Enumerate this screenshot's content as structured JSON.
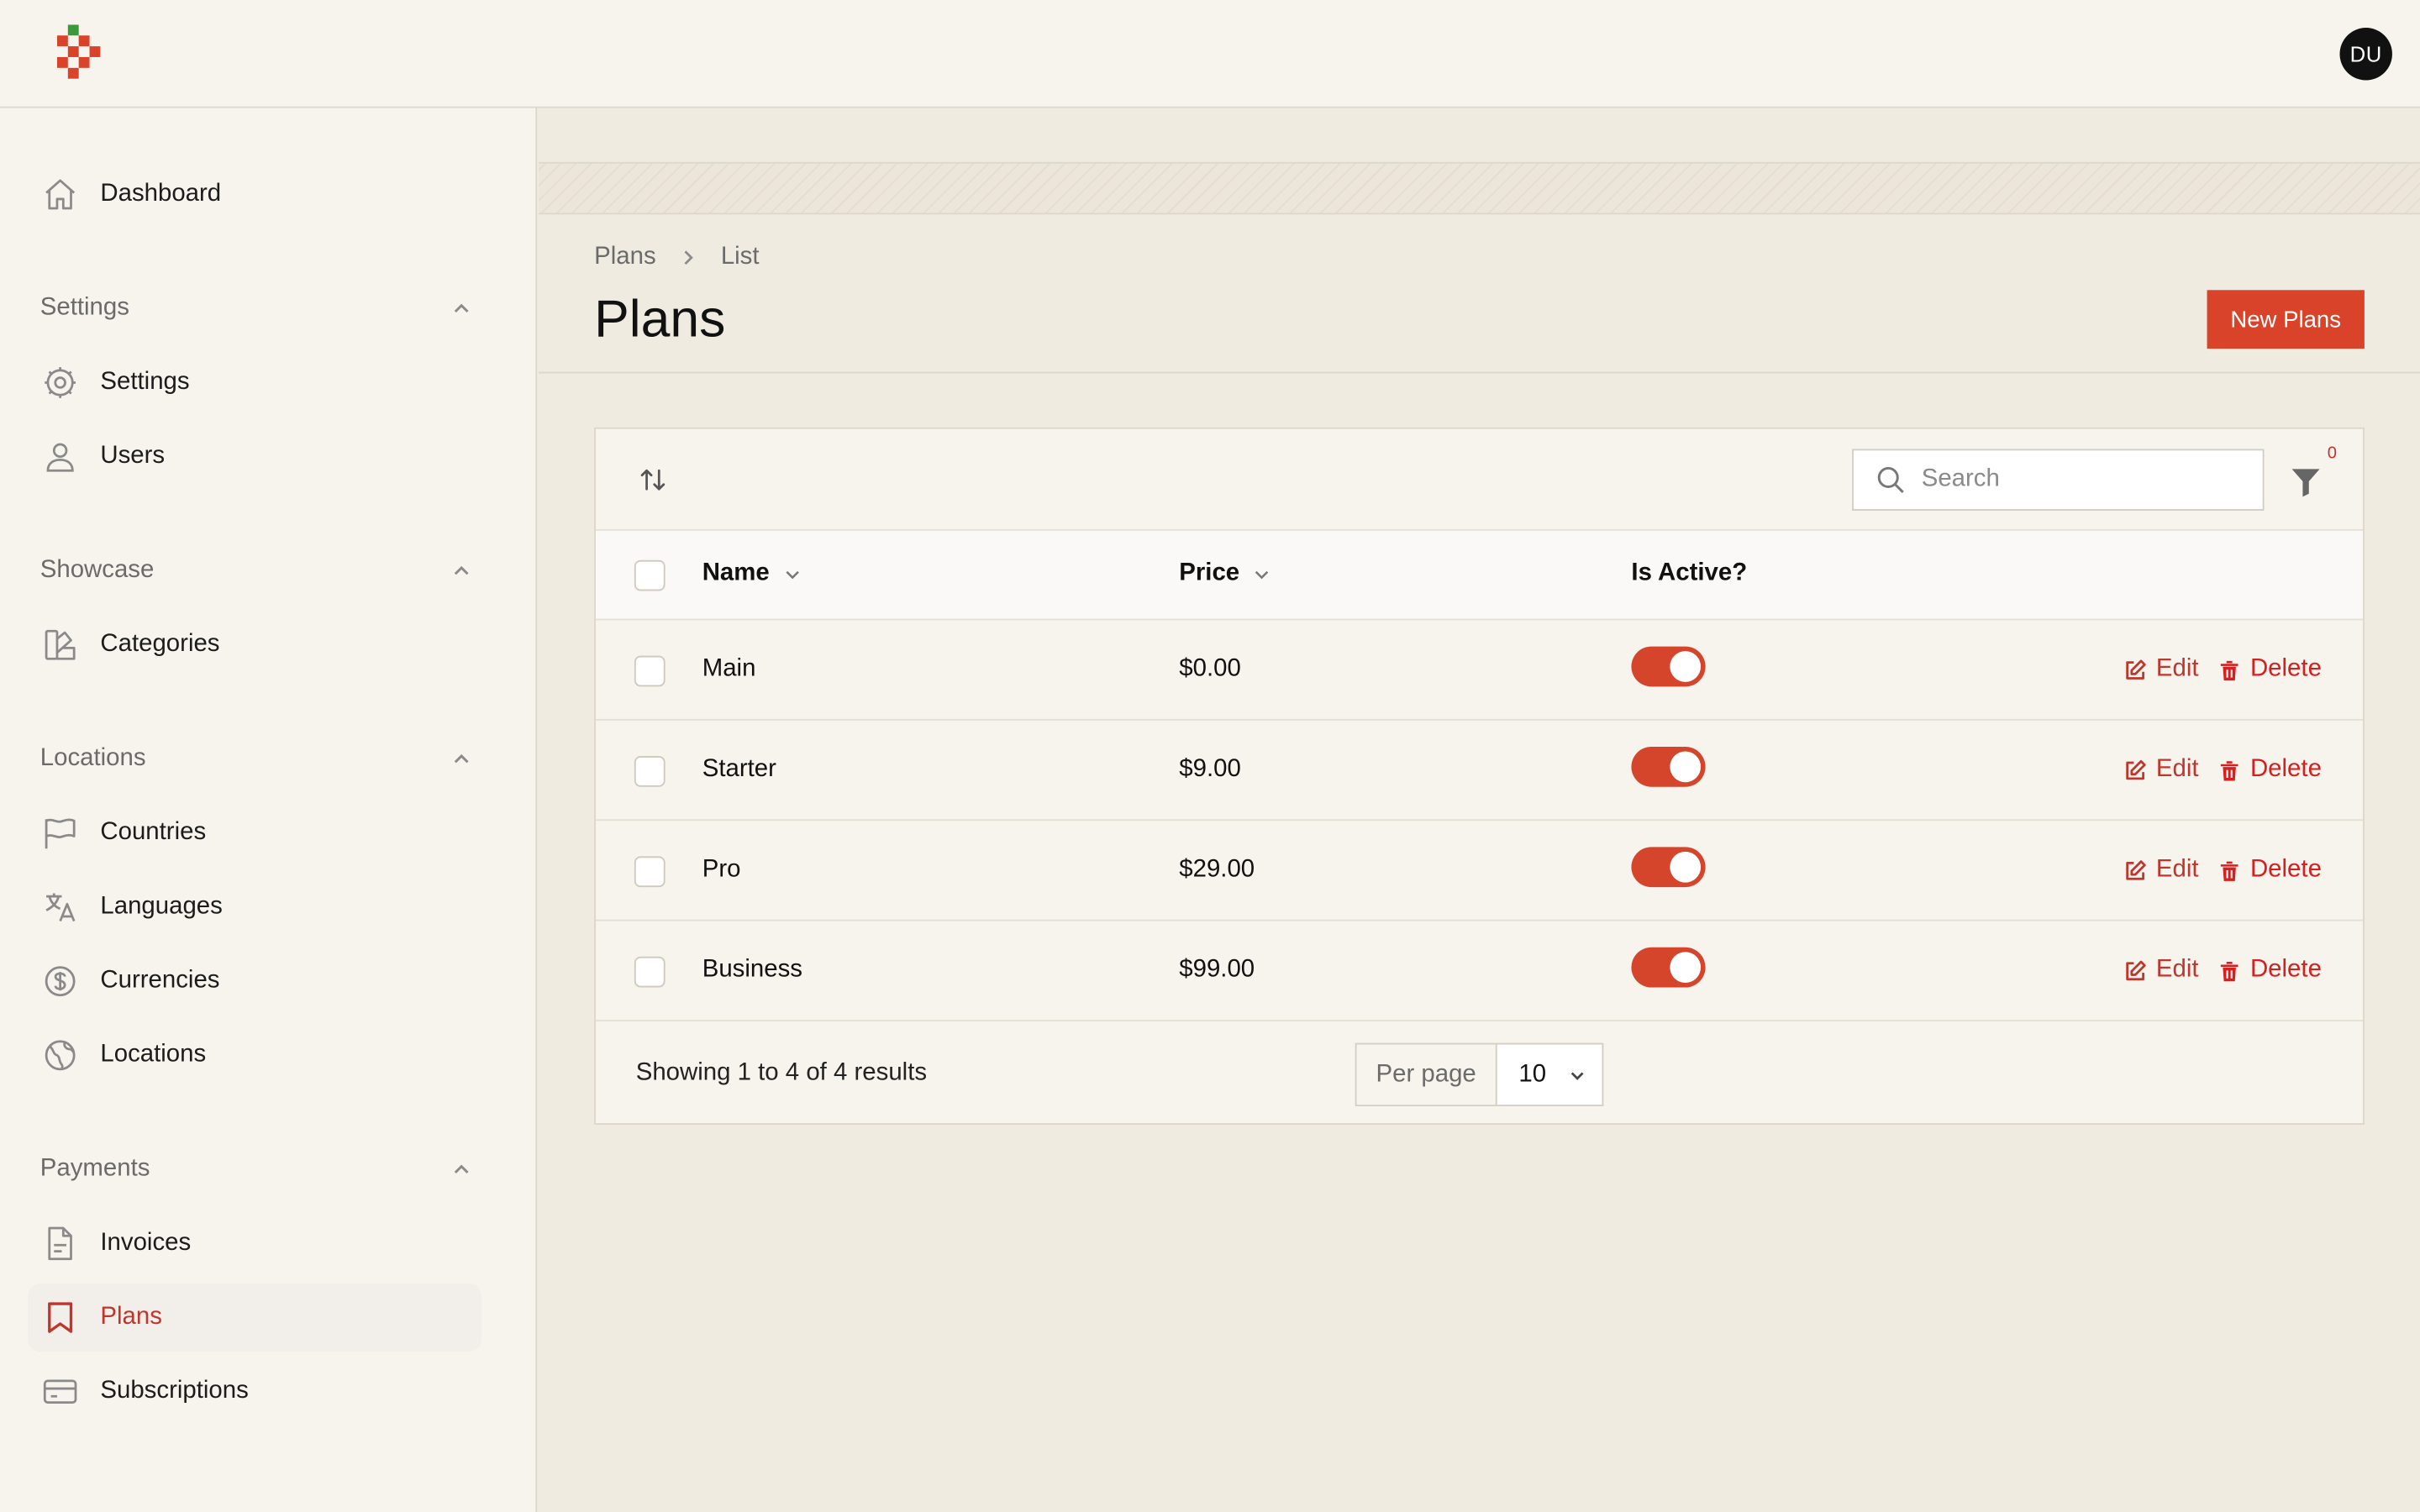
{
  "app": {
    "avatar_initials": "DU",
    "accent_color": "#d8432a"
  },
  "sidebar": {
    "dashboard": {
      "label": "Dashboard",
      "icon": "home-icon"
    },
    "groups": [
      {
        "label": "Settings",
        "items": [
          {
            "label": "Settings",
            "icon": "gear-icon"
          },
          {
            "label": "Users",
            "icon": "user-icon"
          }
        ]
      },
      {
        "label": "Showcase",
        "items": [
          {
            "label": "Categories",
            "icon": "swatch-icon"
          }
        ]
      },
      {
        "label": "Locations",
        "items": [
          {
            "label": "Countries",
            "icon": "flag-icon"
          },
          {
            "label": "Languages",
            "icon": "language-icon"
          },
          {
            "label": "Currencies",
            "icon": "currency-icon"
          },
          {
            "label": "Locations",
            "icon": "globe-icon"
          }
        ]
      },
      {
        "label": "Payments",
        "items": [
          {
            "label": "Invoices",
            "icon": "document-icon"
          },
          {
            "label": "Plans",
            "icon": "bookmark-icon",
            "active": true
          },
          {
            "label": "Subscriptions",
            "icon": "credit-card-icon"
          }
        ]
      }
    ]
  },
  "header": {
    "breadcrumbs": [
      "Plans",
      "List"
    ],
    "title": "Plans",
    "new_button": "New Plans"
  },
  "table": {
    "search_placeholder": "Search",
    "filter_count": "0",
    "columns": [
      "Name",
      "Price",
      "Is Active?"
    ],
    "rows": [
      {
        "name": "Main",
        "price": "$0.00",
        "active": true
      },
      {
        "name": "Starter",
        "price": "$9.00",
        "active": true
      },
      {
        "name": "Pro",
        "price": "$29.00",
        "active": true
      },
      {
        "name": "Business",
        "price": "$99.00",
        "active": true
      }
    ],
    "edit_label": "Edit",
    "delete_label": "Delete",
    "summary": "Showing 1 to 4 of 4 results",
    "per_page_label": "Per page",
    "per_page_value": "10"
  }
}
